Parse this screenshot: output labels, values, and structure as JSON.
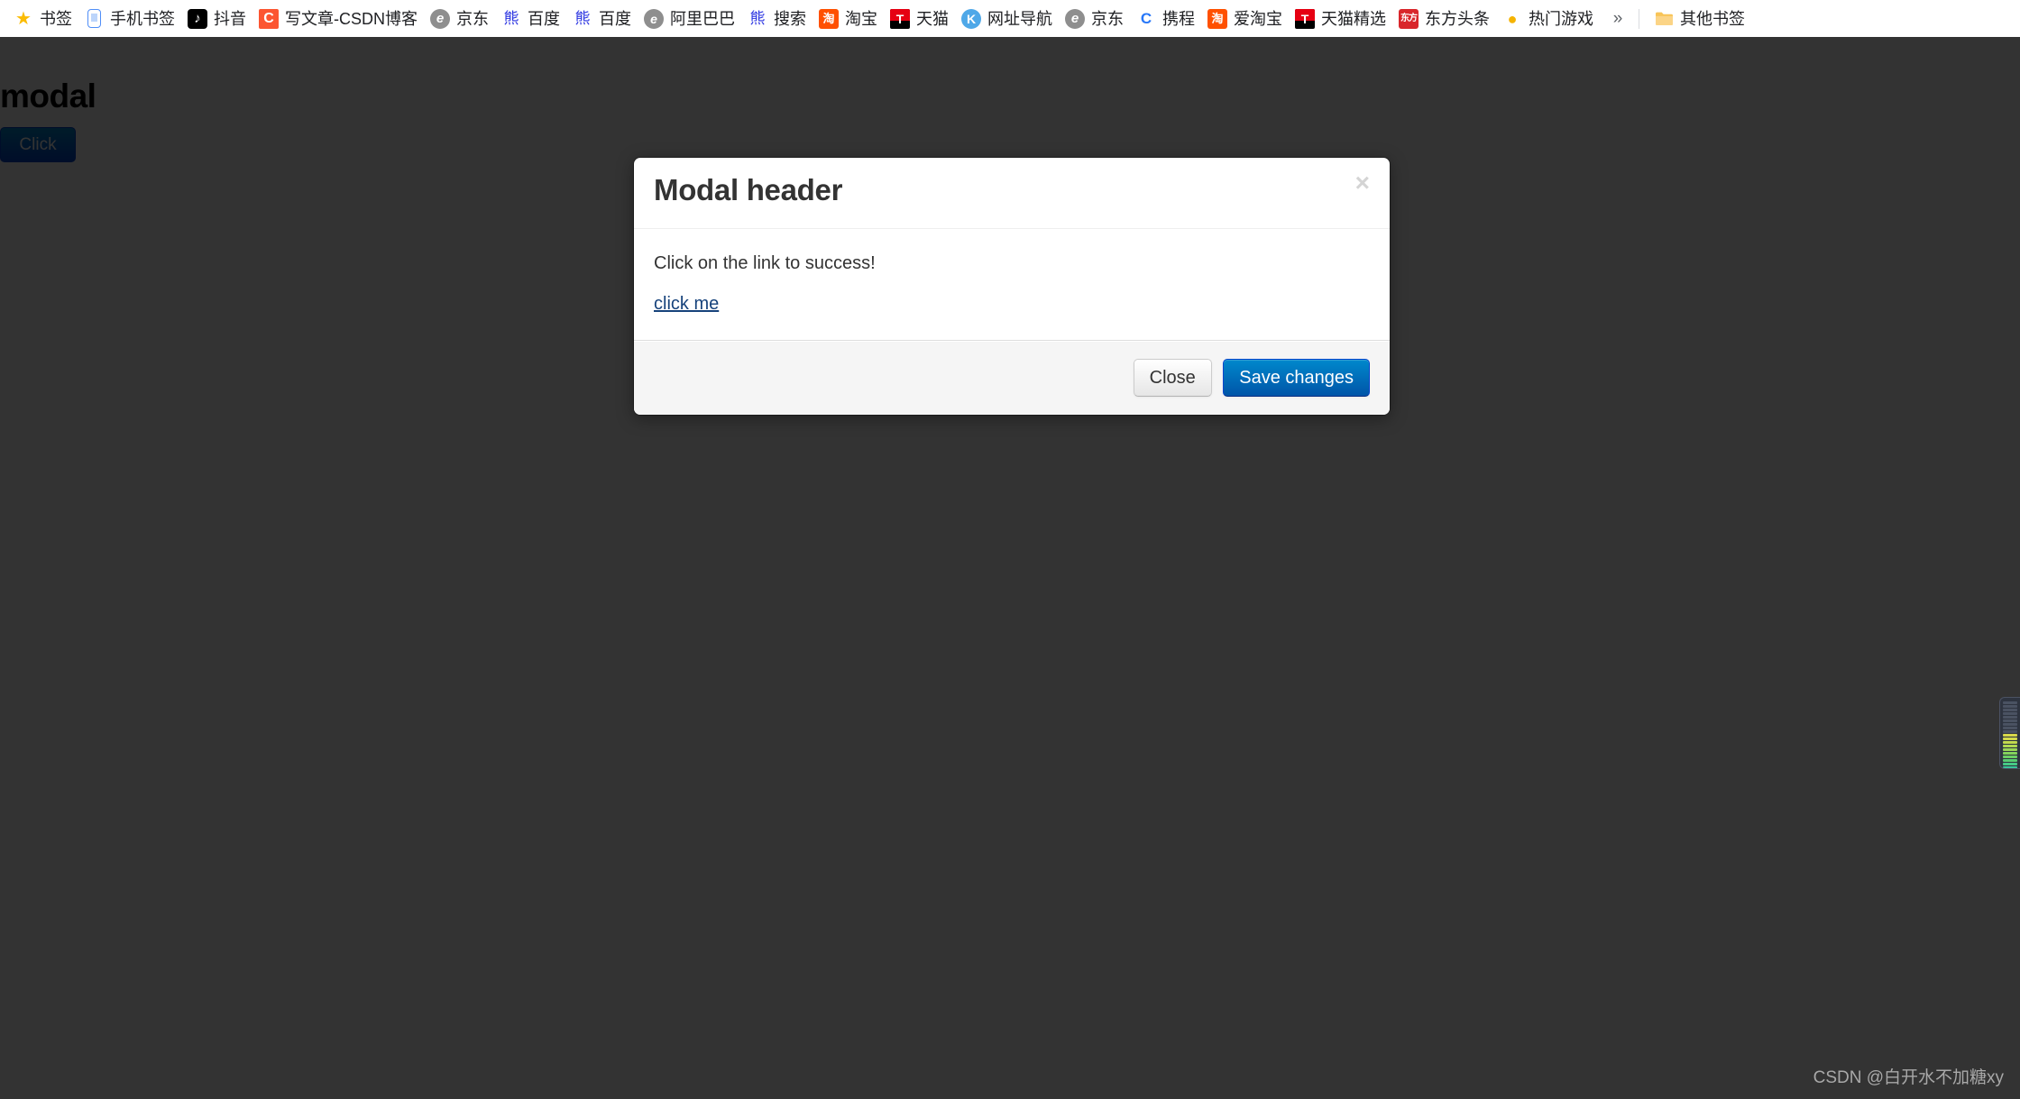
{
  "browser": {
    "bookmarks_bar": {
      "items": [
        {
          "label": "书签",
          "icon": "star-icon",
          "icon_class": "ico-star",
          "glyph": "★"
        },
        {
          "label": "手机书签",
          "icon": "phone-icon",
          "icon_class": "ico-phone",
          "glyph": ""
        },
        {
          "label": "抖音",
          "icon": "douyin-icon",
          "icon_class": "ico-douyin",
          "glyph": "♪"
        },
        {
          "label": "写文章-CSDN博客",
          "icon": "csdn-icon",
          "icon_class": "ico-csdn",
          "glyph": "C"
        },
        {
          "label": "京东",
          "icon": "jingdong-icon",
          "icon_class": "ico-jd",
          "glyph": "e"
        },
        {
          "label": "百度",
          "icon": "baidu-icon",
          "icon_class": "ico-baidu",
          "glyph": "熊"
        },
        {
          "label": "百度",
          "icon": "baidu-icon",
          "icon_class": "ico-baidu",
          "glyph": "熊"
        },
        {
          "label": "阿里巴巴",
          "icon": "alibaba-icon",
          "icon_class": "ico-alibaba",
          "glyph": "e"
        },
        {
          "label": "搜索",
          "icon": "baidu-search-icon",
          "icon_class": "ico-baidu",
          "glyph": "熊"
        },
        {
          "label": "淘宝",
          "icon": "taobao-icon",
          "icon_class": "ico-taobao",
          "glyph": "淘"
        },
        {
          "label": "天猫",
          "icon": "tmall-icon",
          "icon_class": "ico-tmall",
          "glyph": "T"
        },
        {
          "label": "网址导航",
          "icon": "hao123-icon",
          "icon_class": "ico-hao",
          "glyph": "K"
        },
        {
          "label": "京东",
          "icon": "jingdong-icon",
          "icon_class": "ico-jd",
          "glyph": "e"
        },
        {
          "label": "携程",
          "icon": "ctrip-icon",
          "icon_class": "ico-ctrip",
          "glyph": "C"
        },
        {
          "label": "爱淘宝",
          "icon": "taobao-icon",
          "icon_class": "ico-taobao",
          "glyph": "淘"
        },
        {
          "label": "天猫精选",
          "icon": "tmall-icon",
          "icon_class": "ico-tmall",
          "glyph": "T"
        },
        {
          "label": "东方头条",
          "icon": "toutiao-icon",
          "icon_class": "ico-dongfang",
          "glyph": "东方"
        },
        {
          "label": "热门游戏",
          "icon": "game-icon",
          "icon_class": "ico-game",
          "glyph": "●"
        }
      ],
      "overflow_label": "»",
      "other_bookmarks": {
        "label": "其他书签",
        "icon": "folder-icon",
        "glyph": "Ὄ1"
      }
    }
  },
  "page": {
    "title": "modal",
    "trigger_button_label": "Click",
    "background_color": "#ffffff",
    "backdrop_color": "#000000",
    "backdrop_opacity": "0.8"
  },
  "modal": {
    "header_title": "Modal header",
    "close_icon_glyph": "×",
    "body_text": "Click on the link to success!",
    "link_label": "click me",
    "footer": {
      "close_label": "Close",
      "save_label": "Save changes"
    },
    "accent_color": "#0055a8",
    "link_color": "#16427b",
    "footer_background": "#f5f5f5"
  },
  "level_widget": {
    "name": "level-meter",
    "total_segments": 20,
    "lit_segments": 11,
    "unlit_color": "#4a5262",
    "colors": [
      "#d6d64a",
      "#d2d94b",
      "#c3d94e",
      "#b0d851",
      "#9ad556",
      "#82d25c",
      "#6ccf64",
      "#57cc72",
      "#46c985",
      "#3ac69a",
      "#35c4ad"
    ]
  },
  "watermark": {
    "text": "CSDN @白开水不加糖xy"
  }
}
